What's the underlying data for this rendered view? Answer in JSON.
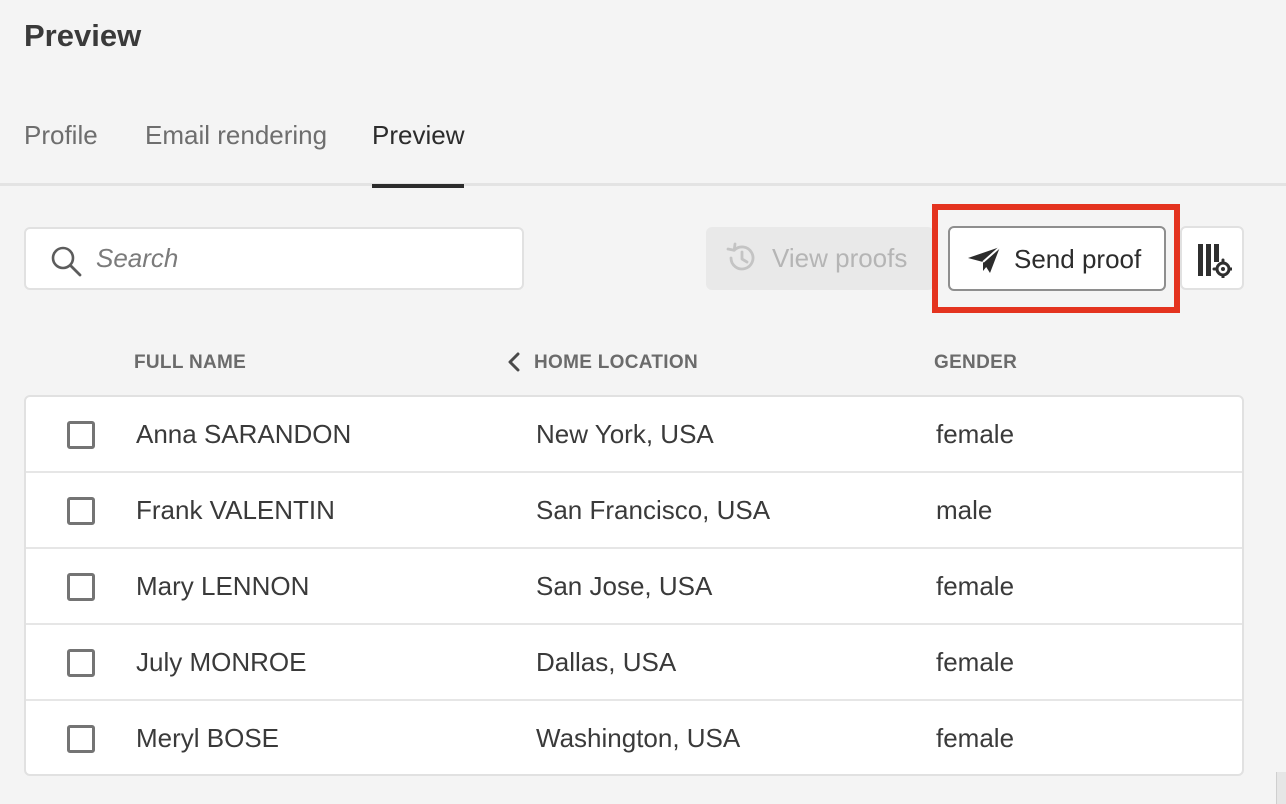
{
  "page": {
    "title": "Preview"
  },
  "tabs": [
    {
      "label": "Profile",
      "selected": false
    },
    {
      "label": "Email rendering",
      "selected": false
    },
    {
      "label": "Preview",
      "selected": true
    }
  ],
  "toolbar": {
    "search_placeholder": "Search",
    "view_proofs_label": "View proofs",
    "view_proofs_disabled": true,
    "send_proof_label": "Send proof",
    "highlight_color": "#e4331f"
  },
  "table": {
    "columns": [
      "FULL NAME",
      "HOME LOCATION",
      "GENDER"
    ],
    "rows": [
      {
        "name": "Anna SARANDON",
        "location": "New York, USA",
        "gender": "female"
      },
      {
        "name": "Frank VALENTIN",
        "location": "San Francisco, USA",
        "gender": "male"
      },
      {
        "name": "Mary LENNON",
        "location": "San Jose, USA",
        "gender": "female"
      },
      {
        "name": "July MONROE",
        "location": "Dallas, USA",
        "gender": "female"
      },
      {
        "name": "Meryl BOSE",
        "location": "Washington, USA",
        "gender": "female"
      }
    ]
  },
  "icons": {
    "search": "search-icon",
    "view_proofs": "history-icon",
    "send_proof": "paper-plane-icon",
    "column_settings": "column-settings-icon",
    "sort": "chevron-left-icon"
  }
}
